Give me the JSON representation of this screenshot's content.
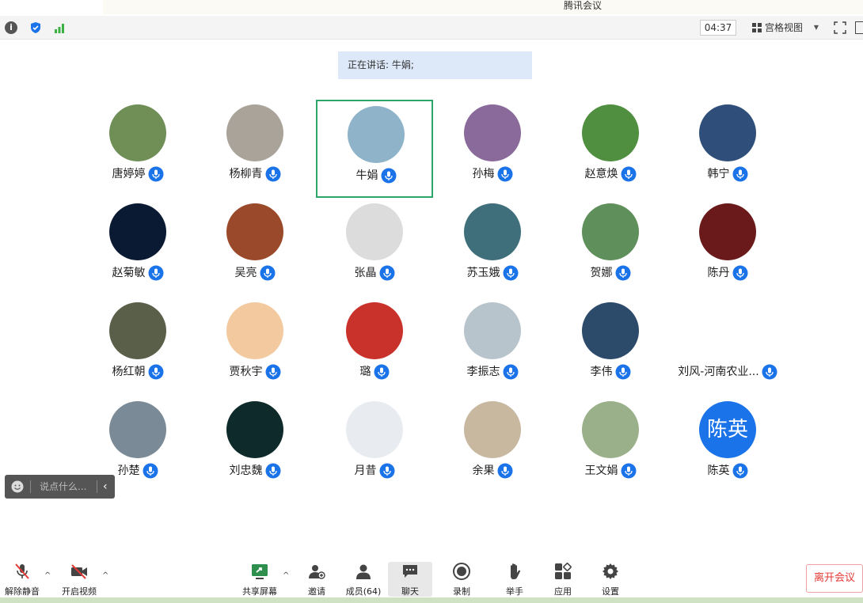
{
  "window": {
    "title": "腾讯会议"
  },
  "toolbar": {
    "timer": "04:37",
    "view_label": "宫格视图"
  },
  "speaking": {
    "text": "正在讲话: 牛娟;"
  },
  "participants": [
    {
      "name": "唐婷婷",
      "bg": "#6f8f57"
    },
    {
      "name": "杨柳青",
      "bg": "#a9a39a"
    },
    {
      "name": "牛娟",
      "bg": "#8fb3c9",
      "active": true
    },
    {
      "name": "孙梅",
      "bg": "#8a6a9a"
    },
    {
      "name": "赵意焕",
      "bg": "#4f8f3f"
    },
    {
      "name": "韩宁",
      "bg": "#2f4f7a"
    },
    {
      "name": "赵菊敏",
      "bg": "#0b1a33"
    },
    {
      "name": "吴亮",
      "bg": "#9a4a2a"
    },
    {
      "name": "张晶",
      "bg": "#dcdcdc"
    },
    {
      "name": "苏玉娥",
      "bg": "#3f6f7a"
    },
    {
      "name": "贺娜",
      "bg": "#5f8f5a"
    },
    {
      "name": "陈丹",
      "bg": "#6a1a1a"
    },
    {
      "name": "杨红朝",
      "bg": "#5a5f4a"
    },
    {
      "name": "贾秋宇",
      "bg": "#f3c9a0"
    },
    {
      "name": "璐",
      "bg": "#c8322a"
    },
    {
      "name": "李振志",
      "bg": "#b8c4cc"
    },
    {
      "name": "李伟",
      "bg": "#2c4a6a"
    },
    {
      "name": "刘风-河南农业...",
      "bg": "#ffffff"
    },
    {
      "name": "孙楚",
      "bg": "#7a8a96"
    },
    {
      "name": "刘忠魏",
      "bg": "#0e2a2a"
    },
    {
      "name": "月昔",
      "bg": "#e8ecf0"
    },
    {
      "name": "余果",
      "bg": "#c9b8a0"
    },
    {
      "name": "王文娟",
      "bg": "#9ab08a"
    },
    {
      "name": "陈英",
      "bg": "#1a73e8",
      "text_avatar": "陈英"
    }
  ],
  "chat": {
    "placeholder": "说点什么..."
  },
  "bottom": {
    "unmute": "解除静音",
    "video": "开启视频",
    "share": "共享屏幕",
    "invite": "邀请",
    "members": "成员(64)",
    "chat": "聊天",
    "record": "录制",
    "raise_hand": "举手",
    "apps": "应用",
    "settings": "设置",
    "leave": "离开会议"
  },
  "colors": {
    "accent": "#1a73e8",
    "active_border": "#2ba56a",
    "leave": "#e53935"
  }
}
